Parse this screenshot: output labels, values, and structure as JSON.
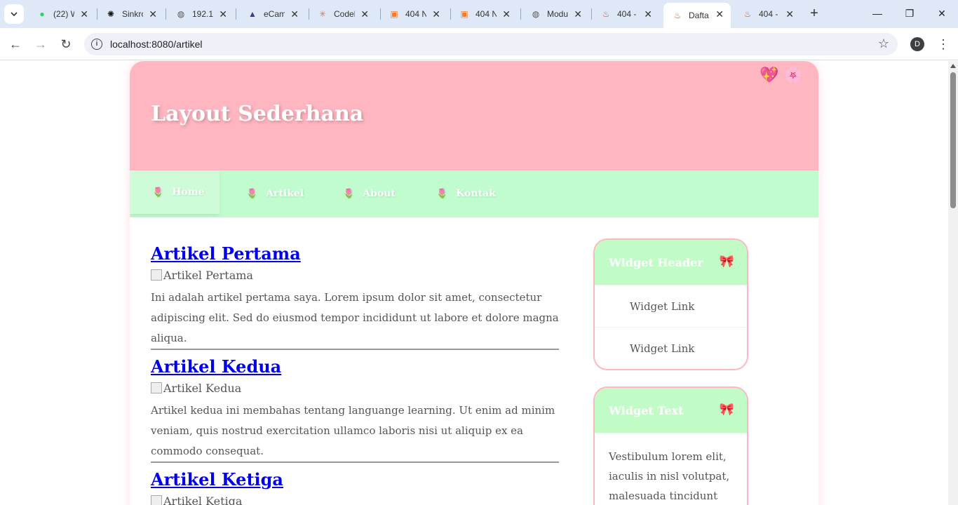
{
  "browser": {
    "tabs": [
      {
        "label": "(22) W",
        "icon": "whatsapp-icon"
      },
      {
        "label": "Sinkro",
        "icon": "openai-icon"
      },
      {
        "label": "192.1",
        "icon": "globe-icon"
      },
      {
        "label": "eCam",
        "icon": "ecampus-icon"
      },
      {
        "label": "Codel",
        "icon": "claude-icon"
      },
      {
        "label": "404 N",
        "icon": "xampp-icon"
      },
      {
        "label": "404 N",
        "icon": "xampp-icon"
      },
      {
        "label": "Modu",
        "icon": "globe-icon"
      },
      {
        "label": "404 -",
        "icon": "flame-icon"
      },
      {
        "label": "Dafta",
        "icon": "flame-icon",
        "active": true
      },
      {
        "label": "404 -",
        "icon": "flame-icon"
      }
    ],
    "url": "localhost:8080/artikel",
    "profile_initial": "D"
  },
  "page": {
    "header_title": "Layout Sederhana",
    "nav": [
      {
        "label": "Home",
        "active": true
      },
      {
        "label": "Artikel"
      },
      {
        "label": "About"
      },
      {
        "label": "Kontak"
      }
    ],
    "articles": [
      {
        "title": "Artikel Pertama",
        "image_alt": "Artikel Pertama",
        "body": "Ini adalah artikel pertama saya. Lorem ipsum dolor sit amet, consectetur adipiscing elit. Sed do eiusmod tempor incididunt ut labore et dolore magna aliqua."
      },
      {
        "title": "Artikel Kedua",
        "image_alt": "Artikel Kedua",
        "body": "Artikel kedua ini membahas tentang languange learning. Ut enim ad minim veniam, quis nostrud exercitation ullamco laboris nisi ut aliquip ex ea commodo consequat."
      },
      {
        "title": "Artikel Ketiga",
        "image_alt": "Artikel Ketiga"
      }
    ],
    "widgets": [
      {
        "title": "Widget Header",
        "links": [
          "Widget Link",
          "Widget Link"
        ]
      },
      {
        "title": "Widget Text",
        "text": "Vestibulum lorem elit, iaculis in nisl volutpat, malesuada tincidunt"
      }
    ]
  },
  "colors": {
    "header_bg": "#ffb6c1",
    "nav_bg": "#c1fccf",
    "widget_head_bg": "#c1fcc6",
    "link": "#0000ee"
  }
}
